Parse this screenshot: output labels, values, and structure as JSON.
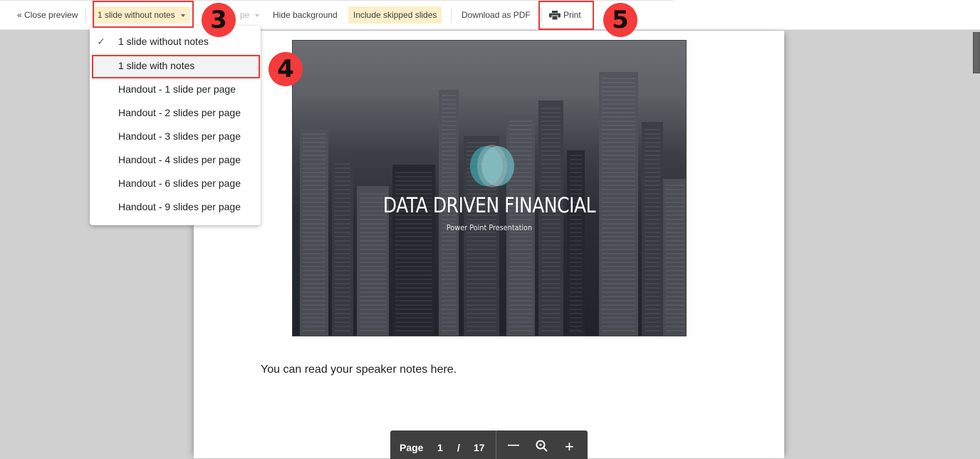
{
  "toolbar": {
    "close_preview": "« Close preview",
    "layout_select": "1 slide without notes",
    "orientation_select": "pe",
    "hide_background": "Hide background",
    "include_skipped": "Include skipped slides",
    "download_pdf": "Download as PDF",
    "print": "Print",
    "print_icon": "printer-icon"
  },
  "annotations": {
    "step3": "3",
    "step4": "4",
    "step5": "5",
    "highlight_color": "#ea3a3a",
    "badge_color": "#f53b3b"
  },
  "layout_menu": {
    "selected": "1 slide without notes",
    "highlighted": "1 slide with notes",
    "check_icon": "checkmark-icon",
    "check_glyph": "✓",
    "items": [
      {
        "label": "1 slide without notes",
        "checked": true
      },
      {
        "label": "1 slide with notes",
        "checked": false
      },
      {
        "label": "Handout - 1 slide per page",
        "checked": false
      },
      {
        "label": "Handout - 2 slides per page",
        "checked": false
      },
      {
        "label": "Handout - 3 slides per page",
        "checked": false
      },
      {
        "label": "Handout - 4 slides per page",
        "checked": false
      },
      {
        "label": "Handout - 6 slides per page",
        "checked": false
      },
      {
        "label": "Handout - 9 slides per page",
        "checked": false
      }
    ]
  },
  "slide": {
    "title": "DATA DRIVEN FINANCIAL",
    "subtitle": "Power Point Presentation"
  },
  "notes": {
    "text": "You can read your speaker notes here."
  },
  "pager": {
    "page_label": "Page",
    "current": "1",
    "separator": "/",
    "total": "17",
    "zoom_out": "—",
    "zoom_icon": "zoom-icon",
    "zoom_in": "+"
  },
  "colors": {
    "active_button_bg": "#fcefc9",
    "preview_bg": "#d0d0d0",
    "pager_bg": "#3f3f3f"
  }
}
